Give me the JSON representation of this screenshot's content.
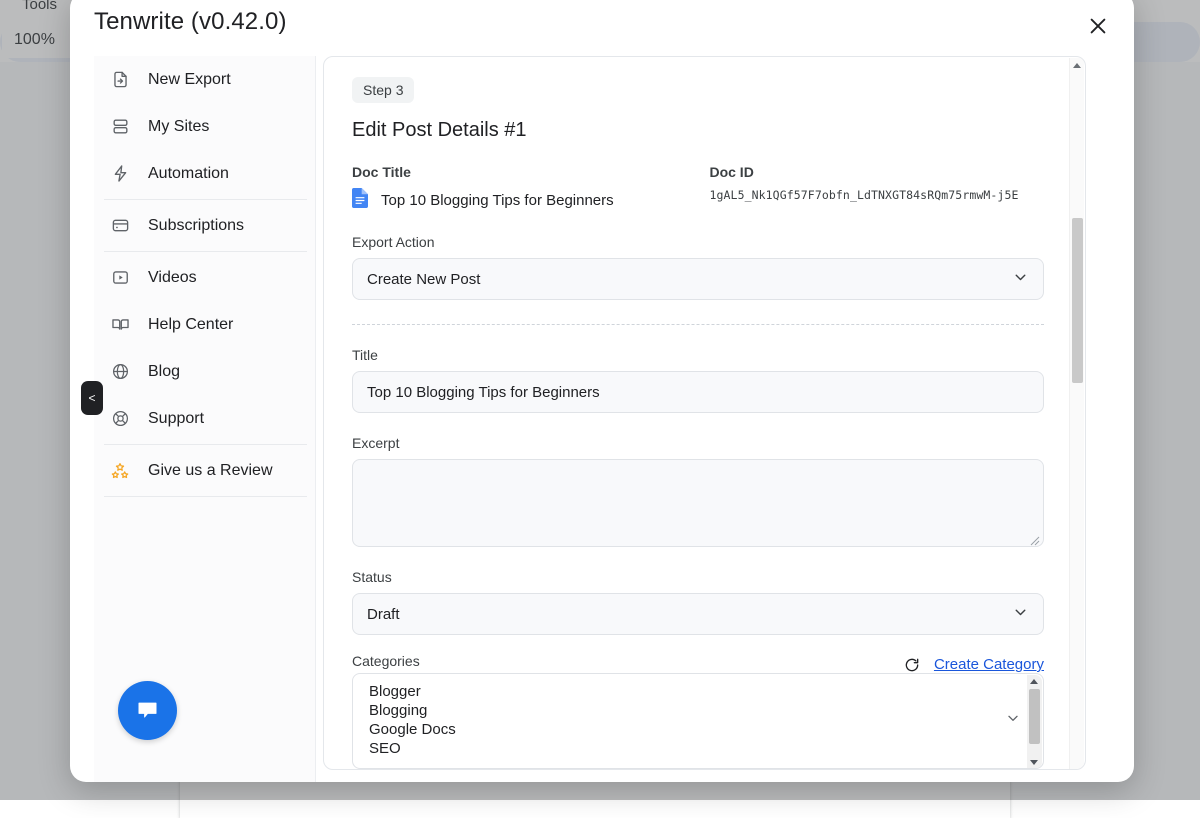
{
  "background": {
    "menus": [
      "Tools"
    ],
    "zoom_level": "100%"
  },
  "modal": {
    "title": "Tenwrite (v0.42.0)",
    "close_label": "×"
  },
  "sidebar": {
    "collapse_label": "<",
    "groups": [
      {
        "items": [
          {
            "label": "New Export",
            "icon": "file-export-icon"
          },
          {
            "label": "My Sites",
            "icon": "stacked-layers-icon"
          },
          {
            "label": "Automation",
            "icon": "lightning-bolt-icon"
          }
        ]
      },
      {
        "items": [
          {
            "label": "Subscriptions",
            "icon": "credit-card-icon"
          }
        ]
      },
      {
        "items": [
          {
            "label": "Videos",
            "icon": "video-play-icon"
          },
          {
            "label": "Help Center",
            "icon": "open-book-icon"
          },
          {
            "label": "Blog",
            "icon": "globe-icon"
          },
          {
            "label": "Support",
            "icon": "lifebuoy-icon"
          }
        ]
      },
      {
        "items": [
          {
            "label": "Give us a Review",
            "icon": "stars-icon"
          }
        ]
      }
    ],
    "chat_widget_icon": "chat-bubble-icon"
  },
  "main": {
    "step_badge": "Step 3",
    "section_title": "Edit Post Details #1",
    "doc_title_label": "Doc Title",
    "doc_title_value": "Top 10 Blogging Tips for Beginners",
    "doc_id_label": "Doc ID",
    "doc_id_value": "1gAL5_Nk1QGf57F7obfn_LdTNXGT84sRQm75rmwM-j5E",
    "export_action_label": "Export Action",
    "export_action_value": "Create New Post",
    "title_label": "Title",
    "title_value": "Top 10 Blogging Tips for Beginners",
    "excerpt_label": "Excerpt",
    "excerpt_value": "",
    "status_label": "Status",
    "status_value": "Draft",
    "categories_label": "Categories",
    "refresh_icon": "refresh-icon",
    "create_category_label": "Create Category",
    "categories": [
      "Blogger",
      "Blogging",
      "Google Docs",
      "SEO"
    ]
  },
  "colors": {
    "accent_blue": "#1a73e8",
    "link_blue": "#1a56db",
    "star_orange": "#f5a623",
    "panel_bg": "#f8f9fb"
  }
}
